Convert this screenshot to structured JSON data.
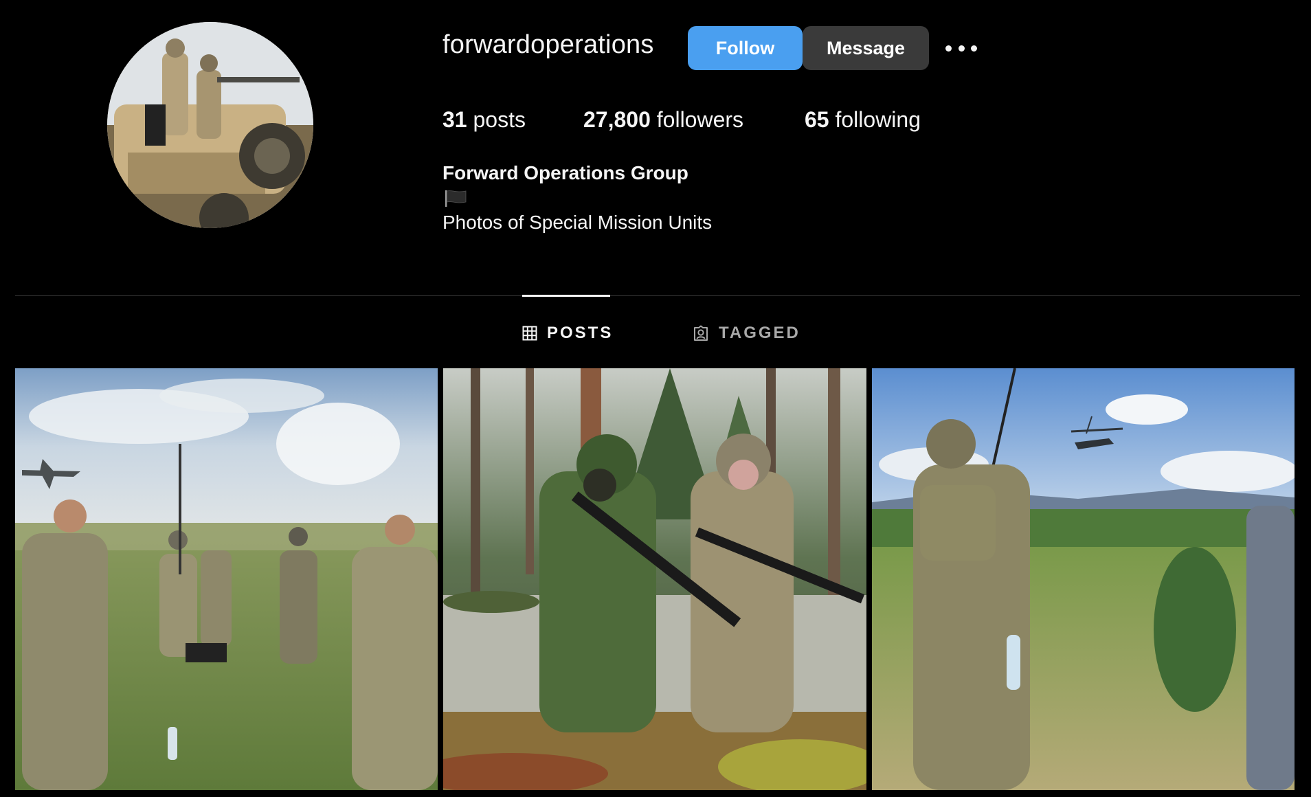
{
  "profile": {
    "username": "forwardoperations",
    "avatar_icon": "profile-avatar-soldiers-vehicle",
    "full_name": "Forward Operations Group",
    "bio_emoji": "black-flag-icon",
    "bio": "Photos of Special Mission Units"
  },
  "actions": {
    "follow_label": "Follow",
    "message_label": "Message",
    "more_icon": "more-options-icon"
  },
  "stats": {
    "posts_count": "31",
    "posts_label": "posts",
    "followers_count": "27,800",
    "followers_label": "followers",
    "following_count": "65",
    "following_label": "following"
  },
  "tabs": [
    {
      "label": "POSTS",
      "icon": "grid-icon",
      "active": true
    },
    {
      "label": "TAGGED",
      "icon": "tagged-user-icon",
      "active": false
    }
  ],
  "posts": [
    {
      "scene": "soldiers-in-field-with-aircraft"
    },
    {
      "scene": "two-soldiers-kneeling-in-forest"
    },
    {
      "scene": "soldier-with-radio-and-helicopter"
    }
  ],
  "colors": {
    "background": "#000000",
    "follow_button": "#4a9ff0",
    "message_button": "#3a3a3a",
    "text": "#f5f5f5",
    "muted_text": "#a8a8a8",
    "divider": "#363636"
  }
}
